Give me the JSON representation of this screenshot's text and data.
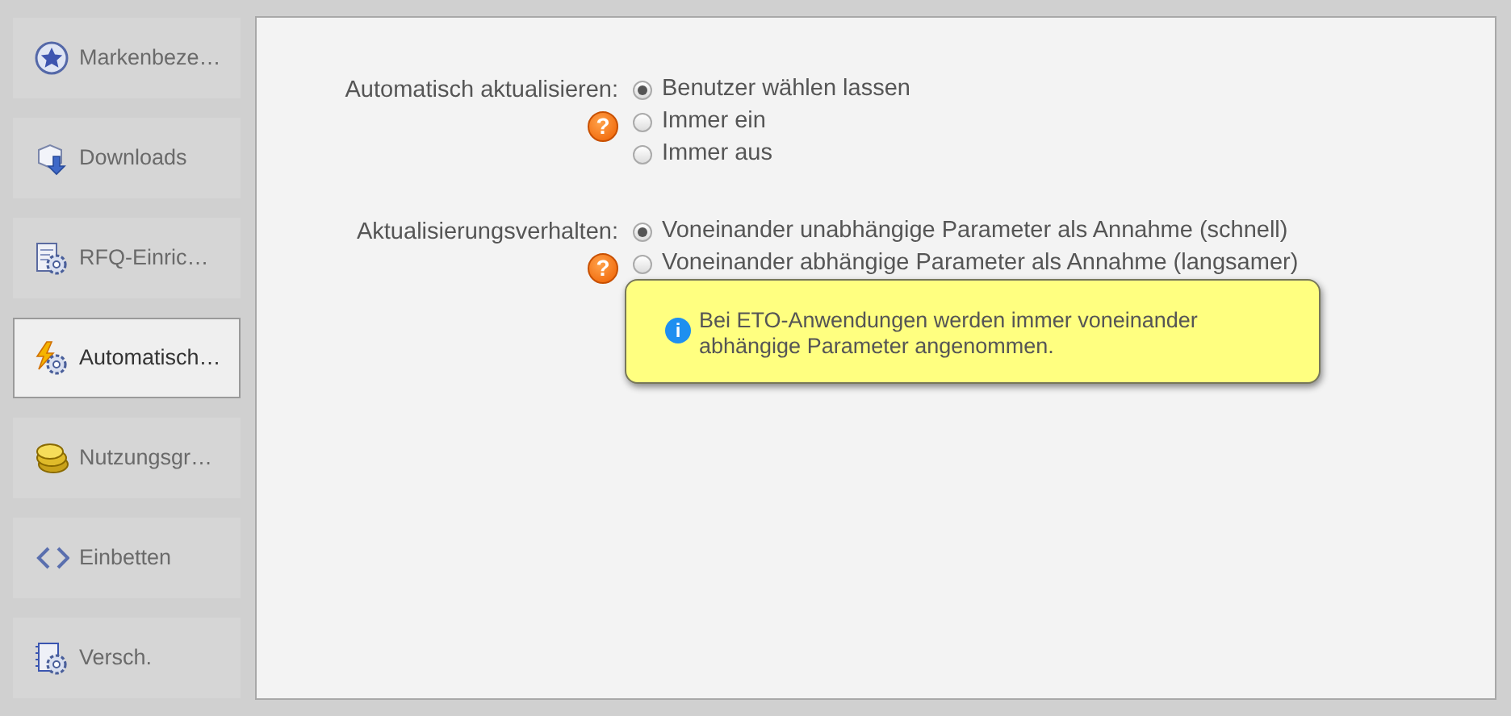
{
  "sidebar": {
    "items": [
      {
        "label": "Markenbeze…",
        "kind": "star",
        "selected": false
      },
      {
        "label": "Downloads",
        "kind": "download",
        "selected": false
      },
      {
        "label": "RFQ-Einric…",
        "kind": "document-gear",
        "selected": false
      },
      {
        "label": "Automatisch…",
        "kind": "lightning-gear",
        "selected": true
      },
      {
        "label": "Nutzungsgr…",
        "kind": "coins",
        "selected": false
      },
      {
        "label": "Einbetten",
        "kind": "code",
        "selected": false
      },
      {
        "label": "Versch.",
        "kind": "notebook-gear",
        "selected": false
      }
    ]
  },
  "settings": [
    {
      "label": "Automatisch aktualisieren:",
      "help": "?",
      "options": [
        {
          "label": "Benutzer wählen lassen",
          "selected": true
        },
        {
          "label": "Immer ein",
          "selected": false
        },
        {
          "label": "Immer aus",
          "selected": false
        }
      ]
    },
    {
      "label": "Aktualisierungsverhalten:",
      "help": "?",
      "options": [
        {
          "label": "Voneinander unabhängige Parameter als Annahme (schnell)",
          "selected": true
        },
        {
          "label": "Voneinander abhängige Parameter als Annahme (langsamer)",
          "selected": false
        }
      ]
    }
  ],
  "tooltip": {
    "icon": "i",
    "text": "Bei ETO-Anwendungen werden immer voneinander abhängige Parameter angenommen."
  }
}
